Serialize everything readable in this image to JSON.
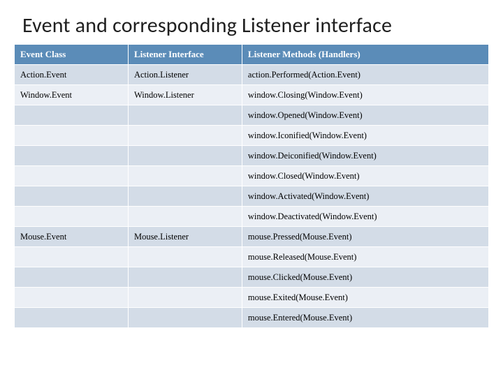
{
  "title": "Event and corresponding Listener interface",
  "headers": {
    "col1": "Event Class",
    "col2": "Listener Interface",
    "col3": "Listener Methods (Handlers)"
  },
  "rows": [
    {
      "event": "Action.Event",
      "listener": "Action.Listener",
      "method": "action.Performed(Action.Event)"
    },
    {
      "event": "Window.Event",
      "listener": "Window.Listener",
      "method": "window.Closing(Window.Event)"
    },
    {
      "event": "",
      "listener": "",
      "method": "window.Opened(Window.Event)"
    },
    {
      "event": "",
      "listener": "",
      "method": "window.Iconified(Window.Event)"
    },
    {
      "event": "",
      "listener": "",
      "method": "window.Deiconified(Window.Event)"
    },
    {
      "event": "",
      "listener": "",
      "method": "window.Closed(Window.Event)"
    },
    {
      "event": "",
      "listener": "",
      "method": "window.Activated(Window.Event)"
    },
    {
      "event": "",
      "listener": "",
      "method": "window.Deactivated(Window.Event)"
    },
    {
      "event": "Mouse.Event",
      "listener": "Mouse.Listener",
      "method": "mouse.Pressed(Mouse.Event)"
    },
    {
      "event": "",
      "listener": "",
      "method": "mouse.Released(Mouse.Event)"
    },
    {
      "event": "",
      "listener": "",
      "method": "mouse.Clicked(Mouse.Event)"
    },
    {
      "event": "",
      "listener": "",
      "method": "mouse.Exited(Mouse.Event)"
    },
    {
      "event": "",
      "listener": "",
      "method": "mouse.Entered(Mouse.Event)"
    }
  ]
}
